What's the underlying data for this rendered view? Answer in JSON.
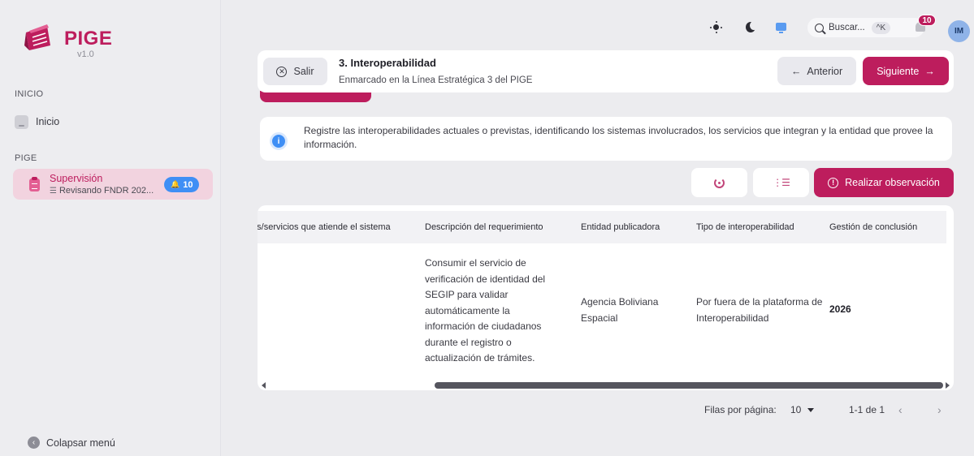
{
  "app": {
    "name": "PIGE",
    "version": "v1.0"
  },
  "sidebar": {
    "section_inicio": "INICIO",
    "home_label": "Inicio",
    "section_pige": "PIGE",
    "active_item": {
      "title": "Supervisión",
      "subtitle": "Revisando FNDR 202...",
      "badge": "10"
    },
    "collapse_label": "Colapsar menú"
  },
  "topbar": {
    "search_placeholder": "Buscar...",
    "search_shortcut": "^K",
    "notification_count": "10",
    "avatar_initials": "IM",
    "icons": [
      "sun-icon",
      "moon-icon",
      "monitor-icon",
      "search-icon",
      "bell-icon"
    ]
  },
  "header": {
    "exit_label": "Salir",
    "title": "3. Interoperabilidad",
    "subtitle": "Enmarcado en la Línea Estratégica 3 del PIGE",
    "prev_label": "Anterior",
    "next_label": "Siguiente"
  },
  "info": {
    "text": "Registre las interoperabilidades actuales o previstas, identificando los sistemas involucrados, los servicios que integran y la entidad que provee la información."
  },
  "actions": {
    "observe_label": "Realizar observación"
  },
  "table": {
    "columns": [
      "tes/servicios que atiende el sistema",
      "Descripción del requerimiento",
      "Entidad publicadora",
      "Tipo de interoperabilidad",
      "Gestión de conclusión"
    ],
    "rows": [
      {
        "servicios": "",
        "descripcion": "Consumir el servicio de verificación de identidad del SEGIP para validar automáticamente la información de ciudadanos durante el registro o actualización de trámites.",
        "entidad": "Agencia Boliviana Espacial",
        "tipo": "Por fuera de la plataforma de Interoperabilidad",
        "gestion": "2026"
      }
    ]
  },
  "pagination": {
    "rows_per_page_label": "Filas por página:",
    "rows_per_page": "10",
    "range": "1-1 de 1"
  },
  "colors": {
    "accent": "#bd1d5d",
    "info_blue": "#3f8ff5",
    "background": "#ececef"
  }
}
